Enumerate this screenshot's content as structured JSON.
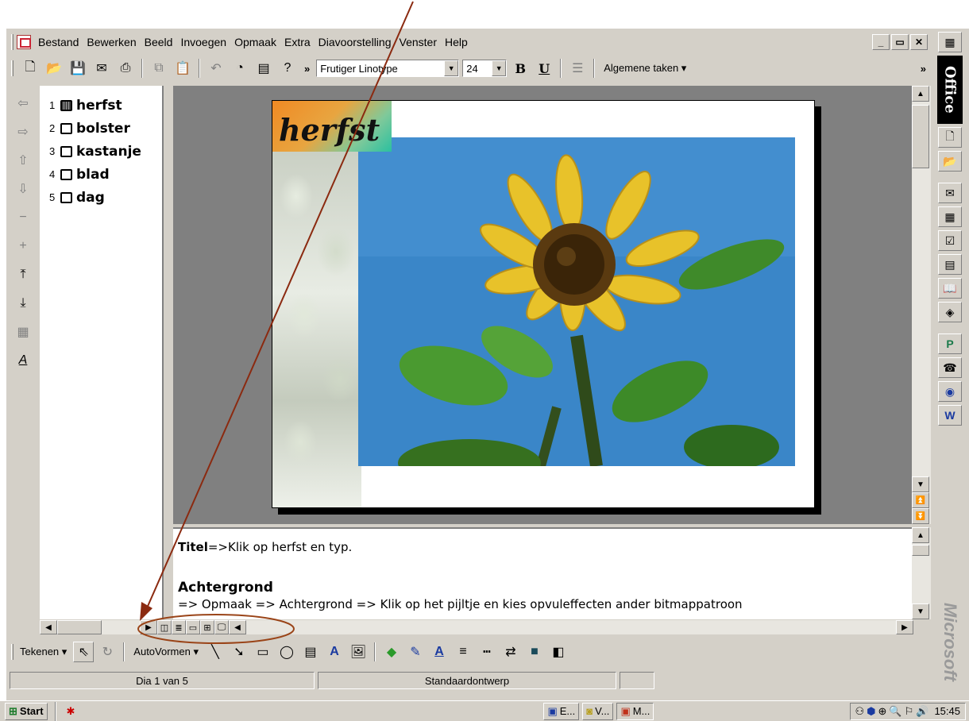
{
  "menubar": {
    "items": [
      {
        "label": "Bestand"
      },
      {
        "label": "Bewerken"
      },
      {
        "label": "Beeld"
      },
      {
        "label": "Invoegen"
      },
      {
        "label": "Opmaak"
      },
      {
        "label": "Extra"
      },
      {
        "label": "Diavoorstelling"
      },
      {
        "label": "Venster"
      },
      {
        "label": "Help"
      }
    ],
    "window_buttons": [
      "_",
      "▭",
      "✕"
    ]
  },
  "toolbar": {
    "font_name": "Frutiger Linotype",
    "font_size": "24",
    "bold_label": "B",
    "underline_label": "U",
    "tasks_label": "Algemene taken ▾",
    "more_label": "»"
  },
  "outline": {
    "slides": [
      {
        "num": "1",
        "title": "herfst"
      },
      {
        "num": "2",
        "title": "bolster"
      },
      {
        "num": "3",
        "title": "kastanje"
      },
      {
        "num": "4",
        "title": "blad"
      },
      {
        "num": "5",
        "title": "dag"
      }
    ]
  },
  "slide": {
    "title": "herfst"
  },
  "notes": {
    "line1_bold": "Titel",
    "line1_rest": "=>Klik op herfst en typ.",
    "line2_bold": "Achtergrond",
    "line3": "=> Opmaak => Achtergrond => Klik op het pijltje en kies opvuleffecten ander bitmappatroon"
  },
  "drawbar": {
    "draw_label": "Tekenen ▾",
    "autoshapes_label": "AutoVormen ▾"
  },
  "statusbar": {
    "slide_position": "Dia 1 van 5",
    "design": "Standaardontwerp"
  },
  "office_bar": {
    "title": "Office",
    "brand": "Microsoft"
  },
  "taskbar": {
    "start_label": "Start",
    "tasks": [
      {
        "label": "E..."
      },
      {
        "label": "V..."
      },
      {
        "label": "M..."
      }
    ],
    "clock": "15:45"
  },
  "colors": {
    "annotation_arrow": "#8b2a10",
    "annotation_circle": "#9a4418",
    "window_face": "#d4d0c8",
    "desktop_gray": "#808080"
  }
}
